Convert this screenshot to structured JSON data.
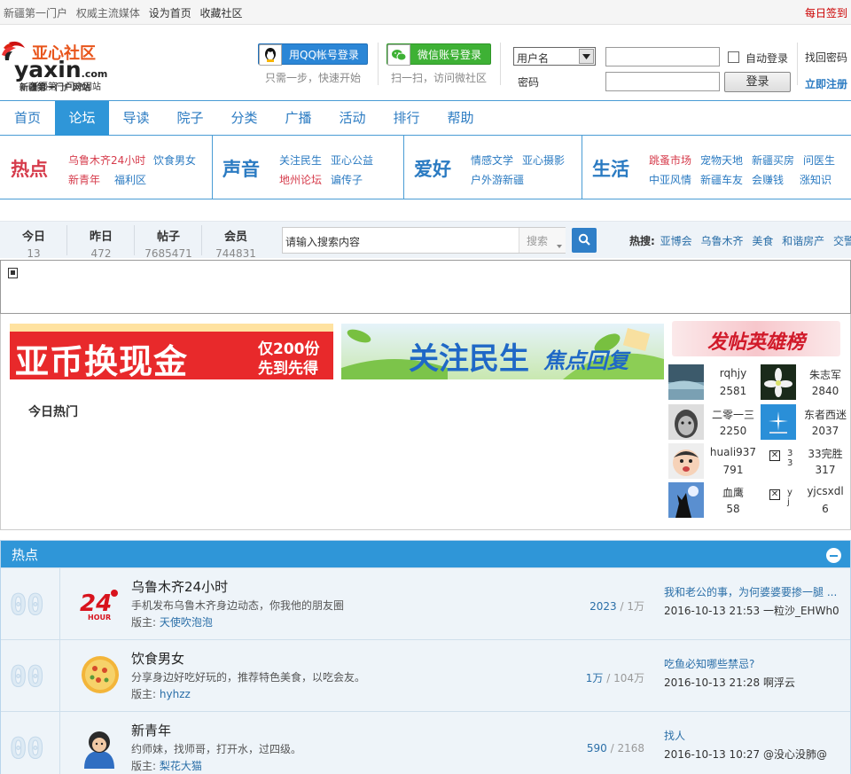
{
  "topbar": {
    "slogan1": "新疆第一门户",
    "slogan2": "权威主流媒体",
    "set_home": "设为首页",
    "favorite": "收藏社区",
    "daily_signin": "每日签到"
  },
  "logo": {
    "title": "亚心社区",
    "brand": "yaxin",
    "domain": ".com",
    "tagline": "新疆第一门户网站"
  },
  "login": {
    "qq_label": "用QQ帐号登录",
    "qq_sub": "只需一步，快速开始",
    "wechat_label": "微信账号登录",
    "wechat_sub": "扫一扫，访问微社区",
    "select_value": "用户名",
    "password_label": "密码",
    "auto_login": "自动登录",
    "login_button": "登录",
    "forgot": "找回密码",
    "register": "立即注册"
  },
  "nav": {
    "items": [
      "首页",
      "论坛",
      "导读",
      "院子",
      "分类",
      "广播",
      "活动",
      "排行",
      "帮助"
    ],
    "active": "论坛"
  },
  "categories": [
    {
      "title": "热点",
      "links": [
        "乌鲁木齐24小时",
        "饮食男女",
        "新青年",
        "福利区"
      ]
    },
    {
      "title": "声音",
      "links": [
        "关注民生",
        "亚心公益",
        "地州论坛",
        "谝传子"
      ]
    },
    {
      "title": "爱好",
      "links": [
        "情感文学",
        "亚心摄影",
        "户外游新疆"
      ]
    },
    {
      "title": "生活",
      "links": [
        "跳蚤市场",
        "宠物天地",
        "新疆买房",
        "问医生",
        "中亚风情",
        "新疆车友",
        "会赚钱",
        "涨知识"
      ]
    }
  ],
  "stats": [
    {
      "label": "今日",
      "value": "13"
    },
    {
      "label": "昨日",
      "value": "472"
    },
    {
      "label": "帖子",
      "value": "7685471"
    },
    {
      "label": "会员",
      "value": "744831"
    }
  ],
  "search": {
    "placeholder": "请输入搜索内容",
    "type": "搜索"
  },
  "hot_search": {
    "label": "热搜:",
    "terms": [
      "亚博会",
      "乌鲁木齐",
      "美食",
      "和谐房产",
      "交警"
    ]
  },
  "banners": {
    "banner1_main": "亚币换现金",
    "banner1_sub1": "仅200份",
    "banner1_sub2": "先到先得",
    "banner2_main": "关注民生",
    "banner2_sub": "焦点回复",
    "heroes_title": "发帖英雄榜"
  },
  "today_hot": "今日热门",
  "heroes": [
    {
      "name": "rqhjy",
      "count": "2581",
      "avatar": "landscape"
    },
    {
      "name": "朱志军",
      "count": "2840",
      "avatar": "flower"
    },
    {
      "name": "二零一三",
      "count": "2250",
      "avatar": "face-bw"
    },
    {
      "name": "东者西迷",
      "count": "2037",
      "avatar": "blue-star"
    },
    {
      "name": "huali937",
      "count": "791",
      "avatar": "baby"
    },
    {
      "name": "33完胜",
      "count": "317",
      "avatar": "broken",
      "alt": "33"
    },
    {
      "name": "血鹰",
      "count": "58",
      "avatar": "wolf"
    },
    {
      "name": "yjcsxdl",
      "count": "6",
      "avatar": "broken",
      "alt": "yj"
    }
  ],
  "forum_section": {
    "title": "热点",
    "rows": [
      {
        "name": "乌鲁木齐24小时",
        "desc": "手机发布乌鲁木齐身边动态，你我他的朋友圈",
        "moderator_label": "版主:",
        "moderator": "天使吹泡泡",
        "threads": "2023",
        "posts": "1万",
        "last_title": "我和老公的事，为何婆婆要掺一腿 ...",
        "last_time": "2016-10-13 21:53",
        "last_user": "一粒沙_EHWh0",
        "today": "00",
        "icon": "24hour"
      },
      {
        "name": "饮食男女",
        "desc": "分享身边好吃好玩的，推荐特色美食，以吃会友。",
        "moderator_label": "版主:",
        "moderator": "hyhzz",
        "threads": "1万",
        "posts": "104万",
        "last_title": "吃鱼必知哪些禁忌?",
        "last_time": "2016-10-13 21:28",
        "last_user": "啊浮云",
        "today": "00",
        "icon": "pizza"
      },
      {
        "name": "新青年",
        "desc": "约师妹，找师哥，打开水，过四级。",
        "moderator_label": "版主:",
        "moderator": "梨花大猫",
        "threads": "590",
        "posts": "2168",
        "last_title": "找人",
        "last_time": "2016-10-13 10:27",
        "last_user": "@没心没肺@",
        "today": "00",
        "icon": "youth"
      }
    ]
  }
}
